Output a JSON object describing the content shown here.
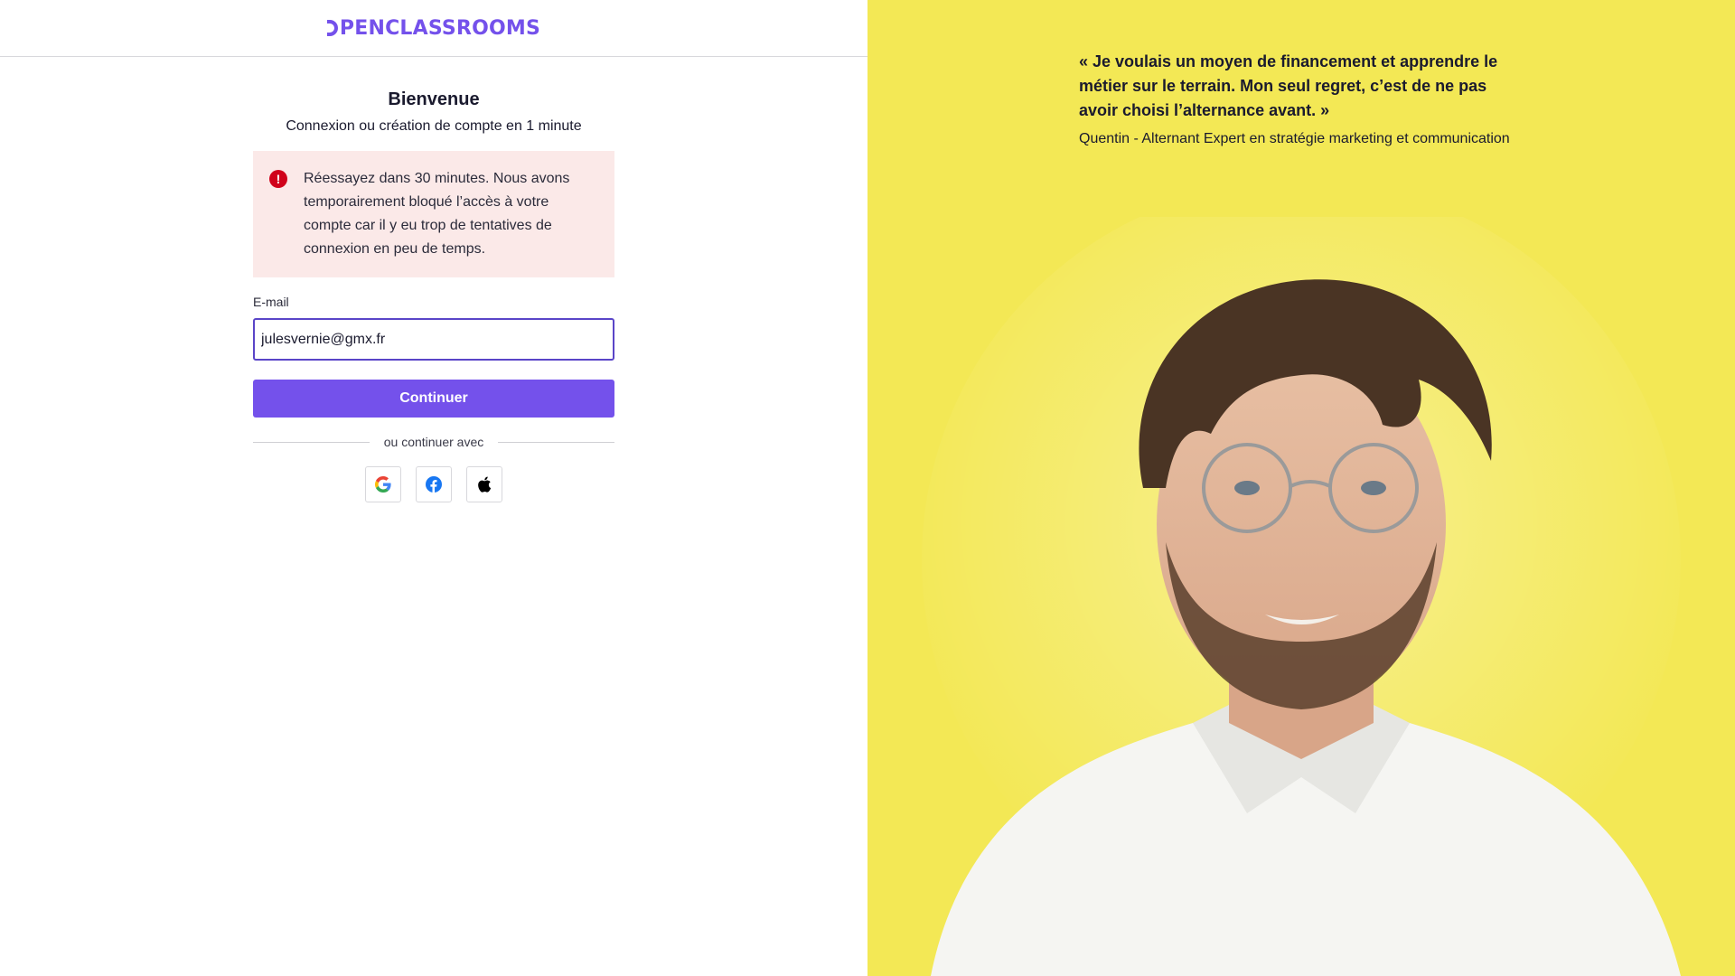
{
  "header": {
    "logo_text": "PENCLASSROOMS",
    "brand_color": "#7451eb"
  },
  "login": {
    "title": "Bienvenue",
    "subtitle": "Connexion ou création de compte en 1 minute",
    "alert": {
      "icon": "error-icon",
      "text": "Réessayez dans 30 minutes. Nous avons temporairement bloqué l’accès à votre compte car il y eu trop de tentatives de connexion en peu de temps."
    },
    "email_label": "E-mail",
    "email_value": "julesvernie@gmx.fr",
    "continue_label": "Continuer",
    "divider_text": "ou continuer avec",
    "social": [
      {
        "name": "google",
        "icon": "google-icon"
      },
      {
        "name": "facebook",
        "icon": "facebook-icon"
      },
      {
        "name": "apple",
        "icon": "apple-icon"
      }
    ]
  },
  "testimonial": {
    "quote": "« Je voulais un moyen de financement et apprendre le métier sur le terrain. Mon seul regret, c’est de ne pas avoir choisi l’alternance avant. »",
    "author": "Quentin - Alternant Expert en stratégie marketing et communication",
    "background_color": "#f3e855"
  }
}
